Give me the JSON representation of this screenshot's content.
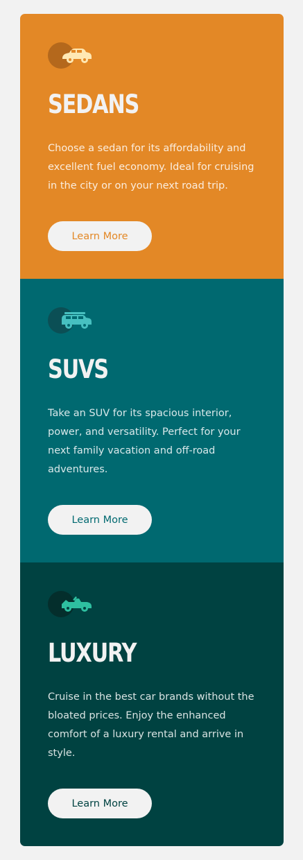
{
  "cards": [
    {
      "title": "SEDANS",
      "description": "Choose a sedan for its affordability and excellent fuel economy. Ideal for cruising in the city or on your next road trip.",
      "button_label": "Learn More",
      "icon": "sedan-car-icon",
      "color": "#e38826"
    },
    {
      "title": "SUVS",
      "description": "Take an SUV for its spacious interior, power, and versatility. Perfect for your next family vacation and off-road adventures.",
      "button_label": "Learn More",
      "icon": "suv-car-icon",
      "color": "#006970"
    },
    {
      "title": "LUXURY",
      "description": "Cruise in the best car brands without the bloated prices. Enjoy the enhanced comfort of a luxury rental and arrive in style.",
      "button_label": "Learn More",
      "icon": "luxury-car-icon",
      "color": "#004241"
    }
  ],
  "colors": {
    "background": "#f2f2f2",
    "sedans_icon": "#ffe8b3",
    "suvs_icon": "#47c0c0",
    "luxury_icon": "#2ebfa0"
  }
}
